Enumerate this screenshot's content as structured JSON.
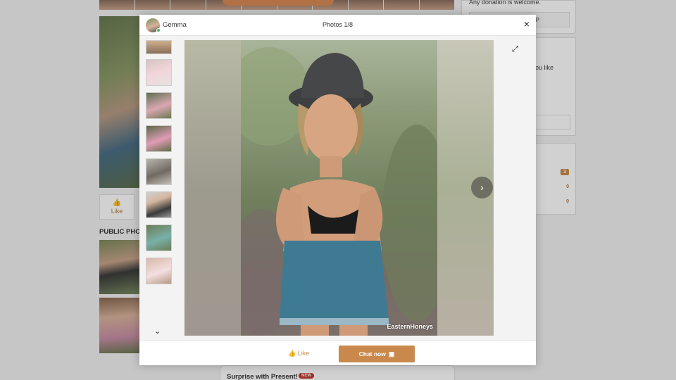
{
  "background": {
    "bg_like_label": "Like",
    "public_photos_heading": "PUBLIC PHOT",
    "right_col": {
      "donation_text": "Any donation is welcome.",
      "btn_suffix": "P",
      "like_text": "ou like",
      "badge_count": "3",
      "count_zero_1": "0",
      "count_zero_2": "0"
    },
    "present": {
      "title": "Surprise with Present!",
      "new_badge": "NEW"
    }
  },
  "modal": {
    "name": "Gemma",
    "photo_counter": "Photos 1/8",
    "close_glyph": "×",
    "thumb_down_glyph": "⌄",
    "next_glyph": "›",
    "expand_glyph": "⤢",
    "watermark": "EasternHoneys",
    "like_label": "Like",
    "chat_label": "Chat now",
    "icons": [
      "close-icon",
      "expand-icon",
      "chevron-right-icon",
      "chevron-down-icon",
      "thumbs-up-icon",
      "chat-bubble-icon"
    ],
    "accent_color": "#c9894d"
  }
}
